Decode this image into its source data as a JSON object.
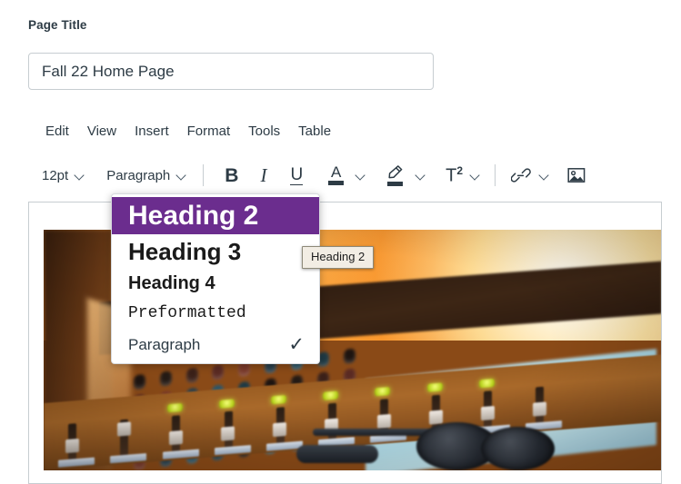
{
  "page": {
    "title_label": "Page Title",
    "title_value": "Fall 22 Home Page",
    "title_placeholder": "Page Title"
  },
  "editor": {
    "menubar": [
      {
        "label": "Edit",
        "name": "menu-edit"
      },
      {
        "label": "View",
        "name": "menu-view"
      },
      {
        "label": "Insert",
        "name": "menu-insert"
      },
      {
        "label": "Format",
        "name": "menu-format"
      },
      {
        "label": "Tools",
        "name": "menu-tools"
      },
      {
        "label": "Table",
        "name": "menu-table"
      }
    ],
    "toolbar": {
      "font_size": "12pt",
      "block_format": "Paragraph",
      "bold": "B",
      "italic": "I",
      "underline": "U",
      "text_color_letter": "A",
      "superscript": "T",
      "superscript_exponent": "2",
      "icons": {
        "font_size_caret": "chevron-down-icon",
        "block_format_caret": "chevron-down-icon",
        "text_color": "text-color-icon",
        "text_color_caret": "chevron-down-icon",
        "highlight_color": "highlight-color-icon",
        "highlight_color_caret": "chevron-down-icon",
        "superscript_caret": "chevron-down-icon",
        "link": "link-icon",
        "link_caret": "chevron-down-icon",
        "image": "image-icon"
      }
    }
  },
  "format_menu": {
    "items": [
      {
        "label": "Heading 2",
        "selected": true,
        "checked": false,
        "style": "fm-h2"
      },
      {
        "label": "Heading 3",
        "selected": false,
        "checked": false,
        "style": "fm-h3"
      },
      {
        "label": "Heading 4",
        "selected": false,
        "checked": false,
        "style": "fm-h4"
      },
      {
        "label": "Preformatted",
        "selected": false,
        "checked": false,
        "style": "fm-pre"
      },
      {
        "label": "Paragraph",
        "selected": false,
        "checked": true,
        "style": "fm-p"
      }
    ],
    "check_glyph": "✓",
    "highlight_color": "#6B2D8E"
  },
  "tooltip": {
    "text": "Heading 2",
    "background": "#F2EDE4"
  },
  "content": {
    "image_alt": "blurred audio mixing console with headphones and warm orange lighting"
  },
  "colors": {
    "text": "#2D3B45",
    "border": "#C7CDD1",
    "accent_purple": "#6B2D8E"
  }
}
